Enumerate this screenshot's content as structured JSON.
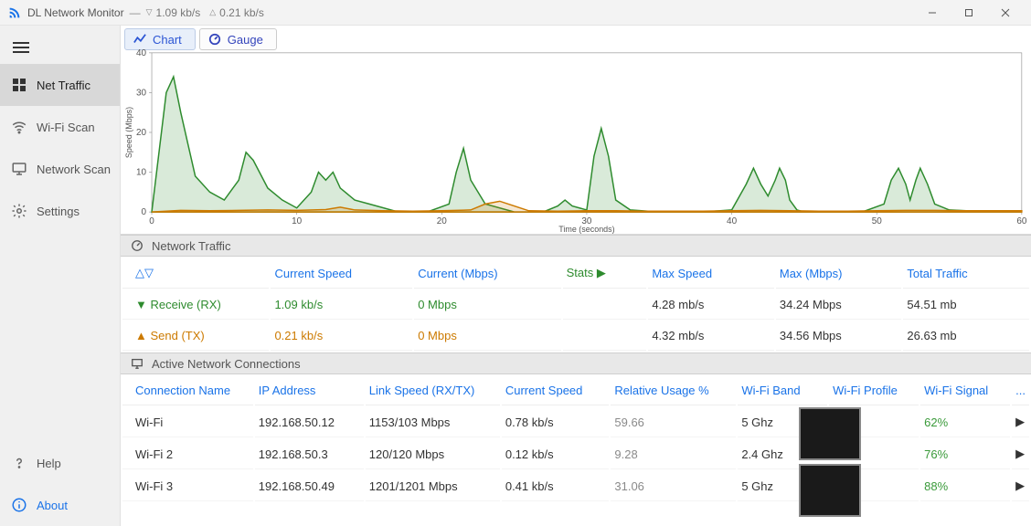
{
  "titlebar": {
    "app_name": "DL Network Monitor",
    "down_rate": "1.09 kb/s",
    "up_rate": "0.21 kb/s"
  },
  "sidebar": {
    "items": [
      {
        "label": "Net Traffic",
        "icon": "grid"
      },
      {
        "label": "Wi-Fi Scan",
        "icon": "wifi"
      },
      {
        "label": "Network Scan",
        "icon": "monitor"
      },
      {
        "label": "Settings",
        "icon": "gear"
      }
    ],
    "help": "Help",
    "about": "About"
  },
  "tabs": {
    "chart": "Chart",
    "gauge": "Gauge"
  },
  "sections": {
    "traffic": "Network Traffic",
    "connections": "Active Network Connections"
  },
  "chart_data": {
    "type": "area",
    "xlabel": "Time (seconds)",
    "ylabel": "Speed (Mbps)",
    "xlim": [
      0,
      60
    ],
    "ylim": [
      0,
      40
    ],
    "xticks": [
      0,
      10,
      20,
      30,
      40,
      50,
      60
    ],
    "yticks": [
      0,
      10,
      20,
      30,
      40
    ],
    "series": [
      {
        "name": "Receive (RX)",
        "color": "#2e8b2e",
        "x": [
          0,
          1,
          1.5,
          2,
          3,
          4,
          5,
          6,
          6.5,
          7,
          8,
          9,
          10,
          11,
          11.5,
          12,
          12.5,
          13,
          14,
          15,
          17,
          19,
          20.5,
          21,
          21.5,
          22,
          23,
          25,
          27,
          28,
          28.5,
          29,
          30,
          30.5,
          31,
          31.5,
          32,
          33,
          35,
          38,
          40,
          41,
          41.5,
          42,
          42.5,
          43,
          43.3,
          43.7,
          44,
          44.5,
          45,
          47,
          49,
          50.5,
          51,
          51.5,
          52,
          52.3,
          52.7,
          53,
          53.5,
          54,
          55,
          58,
          60
        ],
        "y": [
          0,
          30,
          34,
          25,
          9,
          5,
          3,
          8,
          15,
          13,
          6,
          3,
          1,
          5,
          10,
          8,
          10,
          6,
          3,
          2,
          0,
          0,
          2,
          10,
          16,
          8,
          2,
          0,
          0,
          1.5,
          3,
          1.5,
          0.5,
          14,
          21,
          14,
          3,
          0.5,
          0,
          0,
          0.5,
          7,
          11,
          7,
          4,
          8,
          11,
          8,
          3,
          0.5,
          0,
          0,
          0,
          2,
          8,
          11,
          7,
          3,
          8,
          11,
          7,
          2,
          0.5,
          0,
          0
        ]
      },
      {
        "name": "Send (TX)",
        "color": "#cc7a00",
        "x": [
          0,
          2,
          4,
          6,
          8,
          10,
          12,
          13,
          14,
          16,
          18,
          20,
          22,
          23,
          24,
          25,
          26,
          28,
          30,
          32,
          34,
          36,
          38,
          40,
          42,
          44,
          46,
          48,
          50,
          52,
          54,
          56,
          58,
          60
        ],
        "y": [
          0,
          0.4,
          0.3,
          0.4,
          0.5,
          0.4,
          0.6,
          1.2,
          0.5,
          0.3,
          0.2,
          0.3,
          0.5,
          2,
          2.7,
          1.5,
          0.3,
          0.2,
          0.3,
          0.3,
          0.2,
          0.2,
          0.2,
          0.3,
          0.4,
          0.3,
          0.2,
          0.2,
          0.3,
          0.4,
          0.4,
          0.3,
          0.3,
          0.3
        ]
      }
    ]
  },
  "traffic": {
    "headers": {
      "dir": "△▽",
      "cur_speed": "Current Speed",
      "cur_mbps": "Current (Mbps)",
      "stats": "Stats ▶",
      "max_speed": "Max Speed",
      "max_mbps": "Max (Mbps)",
      "total": "Total Traffic"
    },
    "rows": [
      {
        "dir": "▼ Receive (RX)",
        "cur_speed": "1.09 kb/s",
        "cur_mbps": "0 Mbps",
        "max_speed": "4.28 mb/s",
        "max_mbps": "34.24 Mbps",
        "total": "54.51 mb"
      },
      {
        "dir": "▲ Send (TX)",
        "cur_speed": "0.21 kb/s",
        "cur_mbps": "0 Mbps",
        "max_speed": "4.32 mb/s",
        "max_mbps": "34.56 Mbps",
        "total": "26.63 mb"
      }
    ]
  },
  "connections": {
    "headers": {
      "name": "Connection Name",
      "ip": "IP Address",
      "link": "Link Speed (RX/TX)",
      "cur": "Current Speed",
      "usage": "Relative Usage %",
      "band": "Wi-Fi Band",
      "profile": "Wi-Fi Profile",
      "signal": "Wi-Fi Signal",
      "more": "..."
    },
    "rows": [
      {
        "name": "Wi-Fi",
        "ip": "192.168.50.12",
        "link": "1153/103 Mbps",
        "cur": "0.78 kb/s",
        "usage": "59.66",
        "band": "5 Ghz",
        "signal": "62%"
      },
      {
        "name": "Wi-Fi 2",
        "ip": "192.168.50.3",
        "link": "120/120 Mbps",
        "cur": "0.12 kb/s",
        "usage": "9.28",
        "band": "2.4 Ghz",
        "signal": "76%"
      },
      {
        "name": "Wi-Fi 3",
        "ip": "192.168.50.49",
        "link": "1201/1201 Mbps",
        "cur": "0.41 kb/s",
        "usage": "31.06",
        "band": "5 Ghz",
        "signal": "88%"
      }
    ]
  }
}
